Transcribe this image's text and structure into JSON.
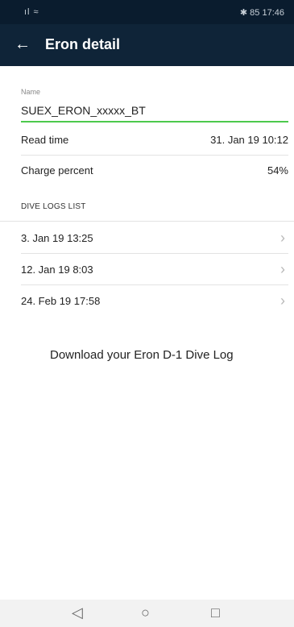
{
  "status": {
    "left": "ıl ≈",
    "right": "✱ 85 17:46"
  },
  "header": {
    "back": "←",
    "title": "Eron detail"
  },
  "name_field": {
    "label": "Name",
    "value": "SUEX_ERON_xxxxx_BT"
  },
  "info_rows": [
    {
      "label": "Read time",
      "value": "31. Jan 19 10:12"
    },
    {
      "label": "Charge percent",
      "value": "54%"
    }
  ],
  "dive_logs": {
    "heading": "DIVE LOGS LIST",
    "items": [
      {
        "date": "3. Jan 19 13:25"
      },
      {
        "date": "12. Jan 19 8:03"
      },
      {
        "date": "24. Feb 19 17:58"
      }
    ],
    "chevron": "›"
  },
  "download_label": "Download your Eron D-1 Dive Log",
  "nav": {
    "back_glyph": "◁",
    "home_glyph": "○",
    "recents_glyph": "□"
  }
}
